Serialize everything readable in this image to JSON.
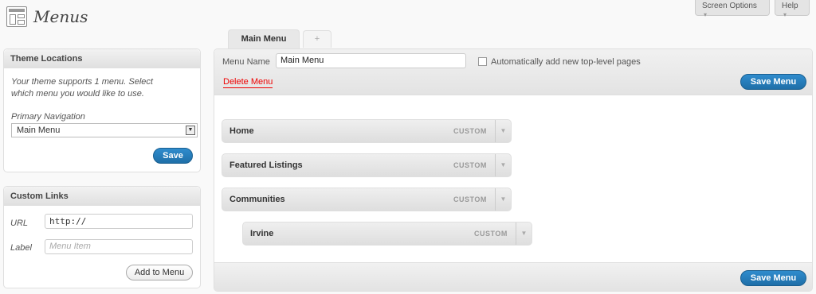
{
  "page": {
    "title": "Menus",
    "icon": "menus-page-icon"
  },
  "header": {
    "screen_options": "Screen Options",
    "help": "Help",
    "dropdown_arrow": "▾"
  },
  "theme_locations": {
    "heading": "Theme Locations",
    "description": "Your theme supports 1 menu. Select which menu you would like to use.",
    "location_label": "Primary Navigation",
    "selected_menu": "Main Menu",
    "save_label": "Save"
  },
  "custom_links": {
    "heading": "Custom Links",
    "url_label": "URL",
    "url_value": "http://",
    "label_label": "Label",
    "label_placeholder": "Menu Item",
    "add_label": "Add to Menu"
  },
  "menu_tabs": {
    "active": "Main Menu",
    "add": "+"
  },
  "editor": {
    "menu_name_label": "Menu Name",
    "menu_name_value": "Main Menu",
    "auto_add_label": "Automatically add new top-level pages",
    "auto_add_checked": false,
    "delete_label": "Delete Menu",
    "save_label": "Save Menu"
  },
  "menu_items": [
    {
      "title": "Home",
      "type": "CUSTOM",
      "depth": 0
    },
    {
      "title": "Featured Listings",
      "type": "CUSTOM",
      "depth": 0
    },
    {
      "title": "Communities",
      "type": "CUSTOM",
      "depth": 0
    },
    {
      "title": "Irvine",
      "type": "CUSTOM",
      "depth": 1
    }
  ],
  "colors": {
    "accent": "#21759b",
    "delete": "#ee0000"
  }
}
